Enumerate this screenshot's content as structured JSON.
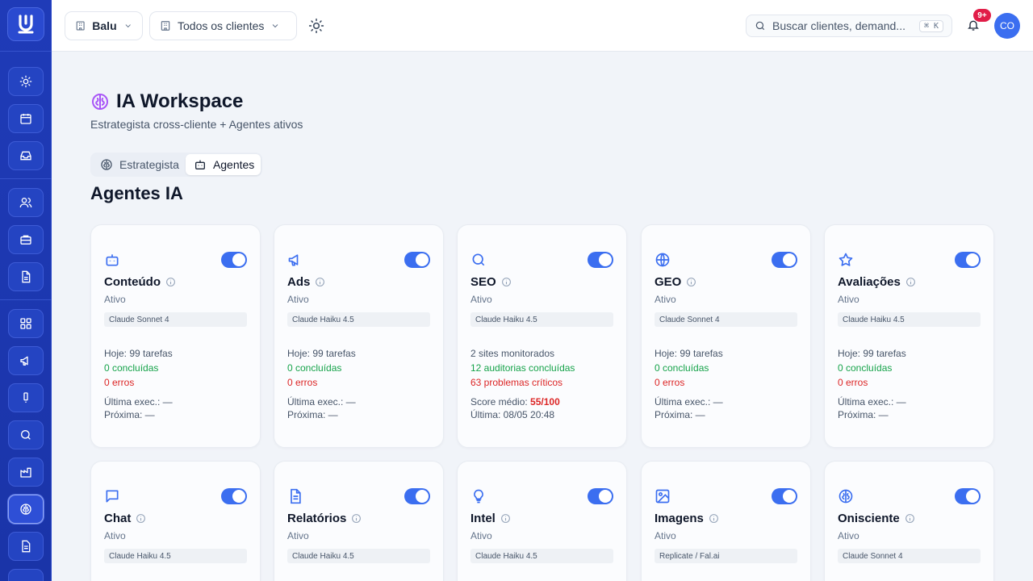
{
  "topbar": {
    "workspace_selector": "Balu",
    "client_selector": "Todos os clientes",
    "search_placeholder": "Buscar clientes, demand...",
    "search_shortcut": "⌘ K",
    "notification_count": "9+",
    "avatar_initials": "CO"
  },
  "header": {
    "title": "IA Workspace",
    "subtitle": "Estrategista cross-cliente + Agentes ativos"
  },
  "tabs": [
    {
      "label": "Estrategista",
      "icon": "brain-icon",
      "active": false
    },
    {
      "label": "Agentes",
      "icon": "bot-icon",
      "active": true
    }
  ],
  "section_title": "Agentes IA",
  "sidebar": {
    "items": [
      "sun-icon",
      "calendar-icon",
      "inbox-icon",
      "users-icon",
      "briefcase-icon",
      "file-text-icon",
      "dashboard-icon",
      "megaphone-icon",
      "alert-icon",
      "search-icon",
      "factory-icon",
      "brain-icon",
      "file-icon"
    ],
    "active": "brain-icon"
  },
  "agents": [
    {
      "name": "Conteúdo",
      "icon": "bot-icon",
      "enabled": true,
      "status": "Ativo",
      "model": "Claude Sonnet 4",
      "stat1": "Hoje: 99 tarefas",
      "stat2": "0 concluídas",
      "stat3": "0 erros",
      "last": "Última exec.: —",
      "next": "Próxima: —"
    },
    {
      "name": "Ads",
      "icon": "megaphone-icon",
      "enabled": true,
      "status": "Ativo",
      "model": "Claude Haiku 4.5",
      "stat1": "Hoje: 99 tarefas",
      "stat2": "0 concluídas",
      "stat3": "0 erros",
      "last": "Última exec.: —",
      "next": "Próxima: —"
    },
    {
      "name": "SEO",
      "icon": "search-icon",
      "enabled": true,
      "status": "Ativo",
      "model": "Claude Haiku 4.5",
      "stat1": "2 sites monitorados",
      "stat2": "12 auditorias concluídas",
      "stat3": "63 problemas críticos",
      "score_label": "Score médio:",
      "score_value": "55/100",
      "next": "Última: 08/05 20:48"
    },
    {
      "name": "GEO",
      "icon": "globe-icon",
      "enabled": true,
      "status": "Ativo",
      "model": "Claude Sonnet 4",
      "stat1": "Hoje: 99 tarefas",
      "stat2": "0 concluídas",
      "stat3": "0 erros",
      "last": "Última exec.: —",
      "next": "Próxima: —"
    },
    {
      "name": "Avaliações",
      "icon": "star-icon",
      "enabled": true,
      "status": "Ativo",
      "model": "Claude Haiku 4.5",
      "stat1": "Hoje: 99 tarefas",
      "stat2": "0 concluídas",
      "stat3": "0 erros",
      "last": "Última exec.: —",
      "next": "Próxima: —"
    },
    {
      "name": "Chat",
      "icon": "chat-icon",
      "enabled": true,
      "status": "Ativo",
      "model": "Claude Haiku 4.5"
    },
    {
      "name": "Relatórios",
      "icon": "document-icon",
      "enabled": true,
      "status": "Ativo",
      "model": "Claude Haiku 4.5"
    },
    {
      "name": "Intel",
      "icon": "lightbulb-icon",
      "enabled": true,
      "status": "Ativo",
      "model": "Claude Haiku 4.5"
    },
    {
      "name": "Imagens",
      "icon": "image-icon",
      "enabled": true,
      "status": "Ativo",
      "model": "Replicate / Fal.ai"
    },
    {
      "name": "Onisciente",
      "icon": "brain-icon",
      "enabled": true,
      "status": "Ativo",
      "model": "Claude Sonnet 4"
    }
  ]
}
